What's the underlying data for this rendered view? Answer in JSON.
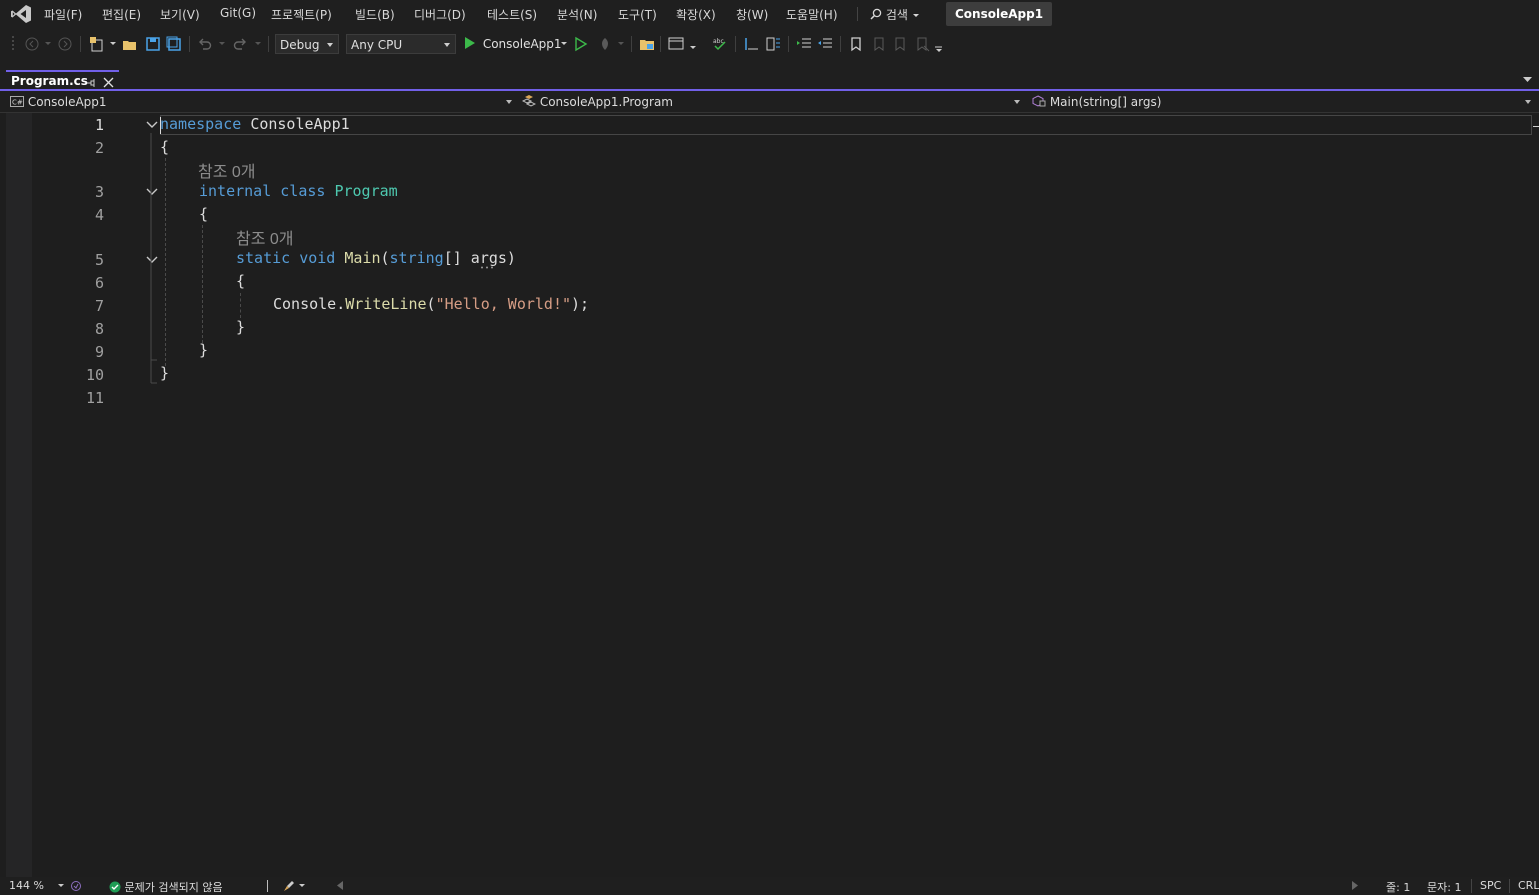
{
  "menubar": {
    "items": [
      "파일(F)",
      "편집(E)",
      "보기(V)",
      "Git(G)",
      "프로젝트(P)",
      "빌드(B)",
      "디버그(D)",
      "테스트(S)",
      "분석(N)",
      "도구(T)",
      "확장(X)",
      "창(W)",
      "도움말(H)"
    ],
    "search_label": "검색",
    "solution_name": "ConsoleApp1"
  },
  "toolbar": {
    "configuration": "Debug",
    "platform": "Any CPU",
    "start_target": "ConsoleApp1"
  },
  "tabs": [
    {
      "label": "Program.cs",
      "active": true
    }
  ],
  "navbar": {
    "project": "ConsoleApp1",
    "type": "ConsoleApp1.Program",
    "member": "Main(string[] args)"
  },
  "editor": {
    "line_numbers": [
      "1",
      "2",
      "3",
      "4",
      "5",
      "6",
      "7",
      "8",
      "9",
      "10",
      "11"
    ],
    "codelens_refs": "참조 0개",
    "code": {
      "l1_kw": "namespace",
      "l1_name": "ConsoleApp1",
      "l2": "{",
      "l3_kw1": "internal",
      "l3_kw2": "class",
      "l3_type": "Program",
      "l4": "{",
      "l5_kw1": "static",
      "l5_kw2": "void",
      "l5_fn": "Main",
      "l5_paren": "(",
      "l5_kw3": "string",
      "l5_rest": "[] args)",
      "l6": "{",
      "l7_obj": "Console",
      "l7_dot": ".",
      "l7_fn": "WriteLine",
      "l7_open": "(",
      "l7_str": "\"Hello, World!\"",
      "l7_close": ");",
      "l8": "}",
      "l9": "}",
      "l10": "}"
    }
  },
  "statusbar": {
    "zoom": "144 %",
    "issues": "문제가 검색되지 않음",
    "line": "줄: 1",
    "char": "문자: 1",
    "whitespace": "SPC",
    "line_ending": "CRL"
  },
  "colors": {
    "accent": "#7160e8",
    "keyword": "#569cd6",
    "type": "#4ec9b0",
    "method": "#dcdcaa",
    "string": "#d69d85",
    "ok_green": "#1f9d55"
  }
}
